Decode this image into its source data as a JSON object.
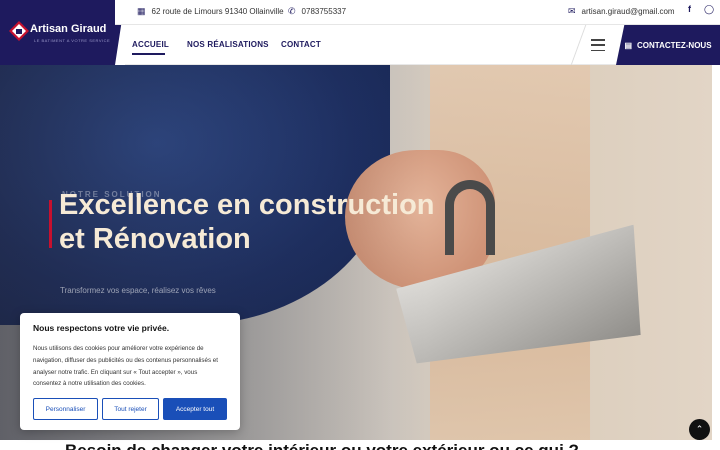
{
  "brand": {
    "name": "Artisan Giraud",
    "tagline": "LE BATIMENT A VOTRE SERVICE"
  },
  "topbar": {
    "address": "62 route de Limours 91340 Ollainville",
    "phone": "0783755337",
    "email": "artisan.giraud@gmail.com",
    "icons": [
      "map-icon",
      "phone-icon",
      "mail-icon",
      "facebook-icon",
      "instagram-icon"
    ]
  },
  "nav": {
    "items": [
      {
        "label": "ACCUEIL",
        "active": true
      },
      {
        "label": "NOS RÉALISATIONS",
        "active": false
      },
      {
        "label": "CONTACT",
        "active": false
      }
    ],
    "cta": "CONTACTEZ-NOUS"
  },
  "hero": {
    "kicker": "NOTRE SOLUTION",
    "title_line1": "Excellence en construction",
    "title_line2": "et Rénovation",
    "subtitle": "Transformez vos espace, réalisez vos rêves"
  },
  "next_section": {
    "heading": "Besoin de changer votre intérieur ou votre extérieur ou ce qui ?"
  },
  "cookie": {
    "title": "Nous respectons votre vie privée.",
    "text": "Nous utilisons des cookies pour améliorer votre expérience de navigation, diffuser des publicités ou des contenus personnalisés et analyser notre trafic. En cliquant sur « Tout accepter », vous consentez à notre utilisation des cookies.",
    "customize": "Personnaliser",
    "reject": "Tout rejeter",
    "accept": "Accepter tout"
  },
  "colors": {
    "brand": "#1e1a5e",
    "accent": "#c8102e",
    "cookie_button": "#1a4fb8"
  }
}
